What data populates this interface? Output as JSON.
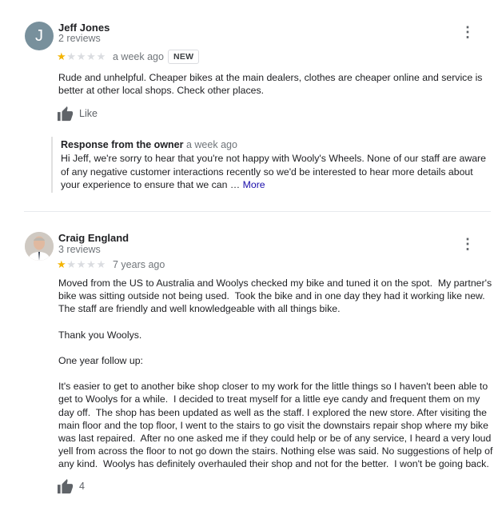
{
  "reviews": [
    {
      "avatar_letter": "J",
      "avatar_color": "#78909c",
      "name": "Jeff Jones",
      "review_count": "2 reviews",
      "rating": 1,
      "time": "a week ago",
      "badge": "NEW",
      "text": "Rude and unhelpful. Cheaper bikes at the main dealers, clothes are cheaper online and service is better at other local shops. Check other places.",
      "like_label": "Like",
      "owner_response": {
        "title": "Response from the owner",
        "time": "a week ago",
        "text": "Hi Jeff, we're sorry to hear that you're not happy with Wooly's Wheels. None of our staff are aware of any negative customer interactions recently so we'd be interested to hear more details about your experience to ensure that we can …",
        "more_label": "More"
      }
    },
    {
      "name": "Craig England",
      "review_count": "3 reviews",
      "rating": 1,
      "time": "7 years ago",
      "text": "Moved from the US to Australia and Woolys checked my bike and tuned it on the spot.  My partner's bike was sitting outside not being used.  Took the bike and in one day they had it working like new.\nThe staff are friendly and well knowledgeable with all things bike.\n\nThank you Woolys.\n\nOne year follow up:\n\nIt's easier to get to another bike shop closer to my work for the little things so I haven't been able to get to Woolys for a while.  I decided to treat myself for a little eye candy and frequent them on my day off.  The shop has been updated as well as the staff. I explored the new store. After visiting the main floor and the top floor, I went to the stairs to go visit the downstairs repair shop where my bike was last repaired.  After no one asked me if they could help or be of any service, I heard a very loud yell from across the floor to not go down the stairs. Nothing else was said. No suggestions of help of any kind.  Woolys has definitely overhauled their shop and not for the better.  I won't be going back.",
      "like_count": "4"
    }
  ],
  "colors": {
    "star_on": "#f4b400",
    "star_off": "#dadce0",
    "link": "#1a0dab"
  },
  "icons": {
    "menu": "more-vertical-icon",
    "like": "thumbs-up-icon",
    "star": "star-icon"
  }
}
